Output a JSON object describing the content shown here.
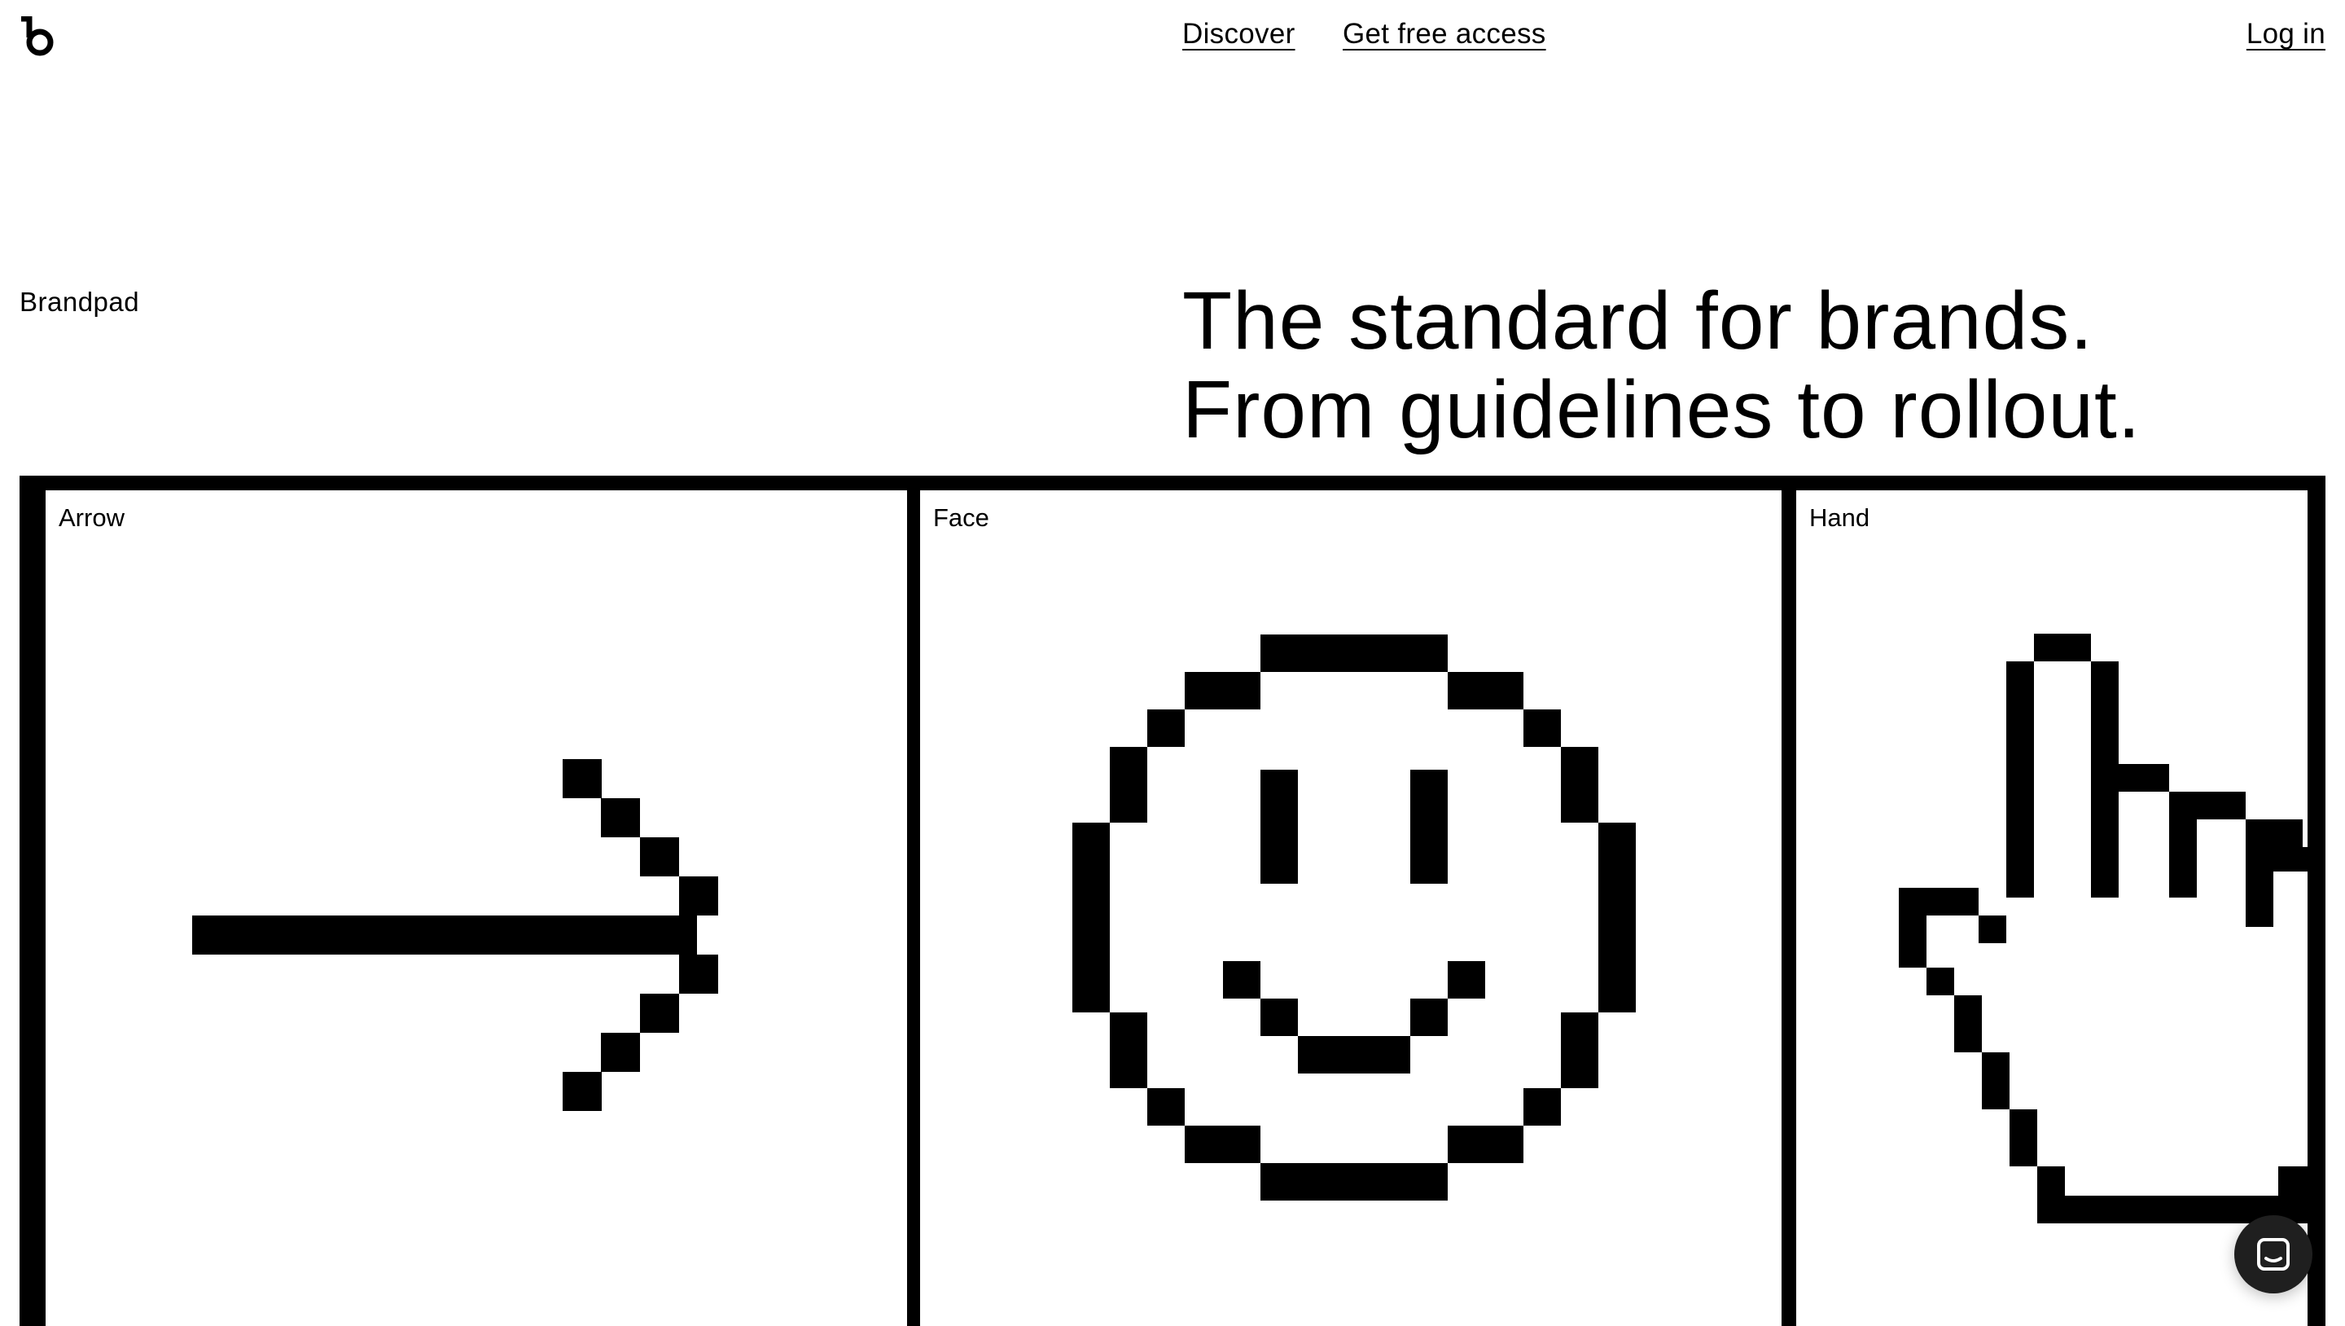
{
  "header": {
    "logo_icon": "brandpad-b-logo-icon",
    "nav": {
      "discover": "Discover",
      "get_free_access": "Get free access",
      "log_in": "Log in"
    }
  },
  "intro": {
    "brand": "Brandpad",
    "headline_line1": "The standard for brands.",
    "headline_line2": "From guidelines to rollout."
  },
  "gallery": {
    "panels": [
      {
        "label": "Arrow",
        "icon": "pixel-arrow-icon"
      },
      {
        "label": "Face",
        "icon": "pixel-smiley-face-icon"
      },
      {
        "label": "Hand",
        "icon": "pixel-pointing-hand-icon"
      }
    ]
  },
  "chat_widget": {
    "icon": "chat-icon"
  },
  "colors": {
    "background": "#ffffff",
    "ink": "#000000",
    "chat_button": "#1f1f1f"
  }
}
